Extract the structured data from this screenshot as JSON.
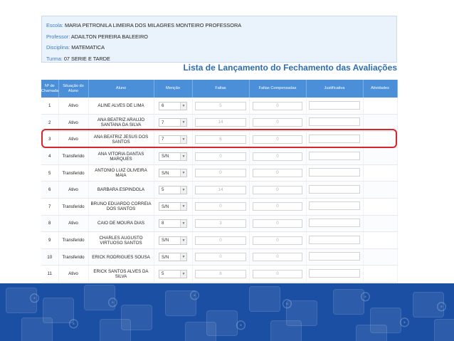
{
  "info": {
    "escola_label": "Escola:",
    "escola_value": "MARIA PETRONILA LIMEIRA DOS MILAGRES MONTEIRO PROFESSORA",
    "professor_label": "Professor:",
    "professor_value": "ADAILTON PEREIRA BALEEIRO",
    "disciplina_label": "Disciplina:",
    "disciplina_value": "MATEMATICA",
    "turma_label": "Turma:",
    "turma_value": "07 SERIE E TARDE"
  },
  "title": "Lista de Lançamento do Fechamento das Avaliações",
  "columns": {
    "numero": "Nº de Chamada",
    "situacao": "Situação do Aluno",
    "aluno": "Aluno",
    "mencao": "Menção",
    "faltas": "Faltas",
    "faltas_compensadas": "Faltas Compensadas",
    "justificativa": "Justificativa",
    "atividades": "Atividades"
  },
  "rows": [
    {
      "numero": "1",
      "situacao": "Ativo",
      "aluno": "ALINE ALVES DE LIMA",
      "mencao": "6",
      "faltas": "5",
      "compensadas": "0"
    },
    {
      "numero": "2",
      "situacao": "Ativo",
      "aluno": "ANA BEATRIZ ARAUJO SANTANA DA SILVA",
      "mencao": "7",
      "faltas": "14",
      "compensadas": "0"
    },
    {
      "numero": "3",
      "situacao": "Ativo",
      "aluno": "ANA BEATRIZ JESUS DOS SANTOS",
      "mencao": "7",
      "faltas": "6",
      "compensadas": "0"
    },
    {
      "numero": "4",
      "situacao": "Transferido",
      "aluno": "ANA VITORIA DANTAS MARQUES",
      "mencao": "S/N",
      "faltas": "0",
      "compensadas": "0"
    },
    {
      "numero": "5",
      "situacao": "Transferido",
      "aluno": "ANTONIO LUIZ OLIVEIRA MAIA",
      "mencao": "S/N",
      "faltas": "0",
      "compensadas": "0"
    },
    {
      "numero": "6",
      "situacao": "Ativo",
      "aluno": "BARBARA ESPINDOLA",
      "mencao": "5",
      "faltas": "14",
      "compensadas": "0"
    },
    {
      "numero": "7",
      "situacao": "Transferido",
      "aluno": "BRUNO EDUARDO CORREIA DOS SANTOS",
      "mencao": "S/N",
      "faltas": "0",
      "compensadas": "0"
    },
    {
      "numero": "8",
      "situacao": "Ativo",
      "aluno": "CAIO DE MOURA DIAS",
      "mencao": "8",
      "faltas": "3",
      "compensadas": "0"
    },
    {
      "numero": "9",
      "situacao": "Transferido",
      "aluno": "CHARLES AUGUSTO VIRTUOSO SANTOS",
      "mencao": "S/N",
      "faltas": "0",
      "compensadas": "0"
    },
    {
      "numero": "10",
      "situacao": "Transferido",
      "aluno": "ERICK RODRIGUES SOUSA",
      "mencao": "S/N",
      "faltas": "0",
      "compensadas": "0"
    },
    {
      "numero": "11",
      "situacao": "Ativo",
      "aluno": "ERICK SANTOS ALVES DA SILVA",
      "mencao": "5",
      "faltas": "8",
      "compensadas": "0"
    }
  ],
  "highlighted_row": "3",
  "colors": {
    "header": "#4a8fd8",
    "title": "#2c6db6",
    "highlight": "#d9232d",
    "footer": "#1b4fa3"
  },
  "icons": {
    "dropdown": "chevron-down-icon",
    "footer_pattern": "mouse-icon"
  }
}
